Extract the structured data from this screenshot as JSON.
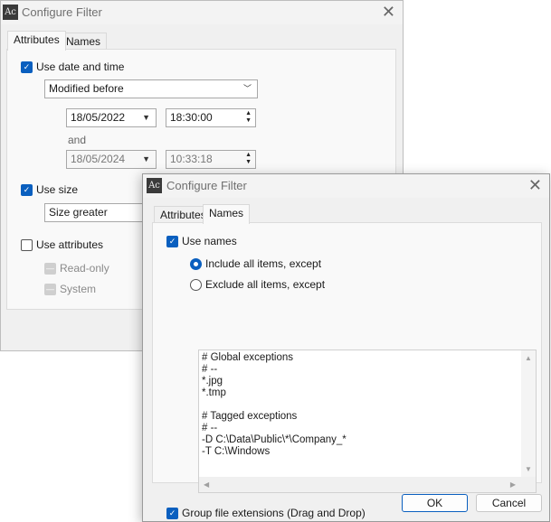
{
  "back_dialog": {
    "title": "Configure Filter",
    "tabs": [
      "Attributes",
      "Names"
    ],
    "use_date_time": {
      "label": "Use date and time",
      "checked": true
    },
    "date_mode": "Modified before",
    "date1": "18/05/2022",
    "time1": "18:30:00",
    "and_label": "and",
    "date2": "18/05/2024",
    "time2": "10:33:18",
    "use_size": {
      "label": "Use size",
      "checked": true
    },
    "size_mode": "Size greater",
    "use_attributes": {
      "label": "Use attributes",
      "checked": false
    },
    "attr_readonly": "Read-only",
    "attr_system": "System"
  },
  "front_dialog": {
    "title": "Configure Filter",
    "tabs": [
      "Attributes",
      "Names"
    ],
    "use_names": {
      "label": "Use names",
      "checked": true
    },
    "radio_include": "Include all items, except",
    "radio_exclude": "Exclude all items, except",
    "selected_radio": "include",
    "exceptions_text": "# Global exceptions\n# --\n*.jpg\n*.tmp\n\n# Tagged exceptions\n# --\n-D C:\\Data\\Public\\*\\Company_*\n-T C:\\Windows",
    "group_ext": {
      "label": "Group file extensions (Drag and Drop)",
      "checked": true
    },
    "ok": "OK",
    "cancel": "Cancel"
  },
  "icons": {
    "app": "Ac",
    "close": "✕",
    "check": "✓"
  }
}
